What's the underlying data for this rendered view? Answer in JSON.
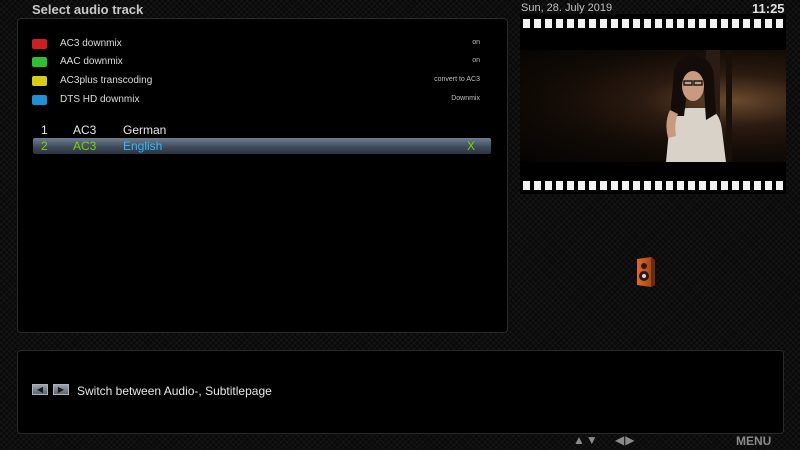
{
  "header": {
    "title": "Select audio track",
    "date": "Sun, 28. July 2019",
    "clock": "11:25"
  },
  "options": [
    {
      "label": "AC3 downmix",
      "value": "on",
      "color": "#cc1f1f"
    },
    {
      "label": "AAC downmix",
      "value": "on",
      "color": "#2fc02f"
    },
    {
      "label": "AC3plus transcoding",
      "value": "convert to AC3",
      "color": "#d8cc14"
    },
    {
      "label": "DTS HD downmix",
      "value": "Downmix",
      "color": "#1f8fd6"
    }
  ],
  "tracks": [
    {
      "num": "1",
      "codec": "AC3",
      "language": "German",
      "mark": "",
      "selected": false
    },
    {
      "num": "2",
      "codec": "AC3",
      "language": "English",
      "mark": "X",
      "selected": true
    }
  ],
  "help": {
    "left_key": "◀",
    "right_key": "▶",
    "text": "Switch between Audio-, Subtitlepage"
  },
  "footer": {
    "up_down": "▲▼",
    "left_right": "◀▶",
    "menu": "MENU"
  },
  "icons": {
    "preview": "film-strip-icon",
    "speaker": "speaker-icon"
  }
}
